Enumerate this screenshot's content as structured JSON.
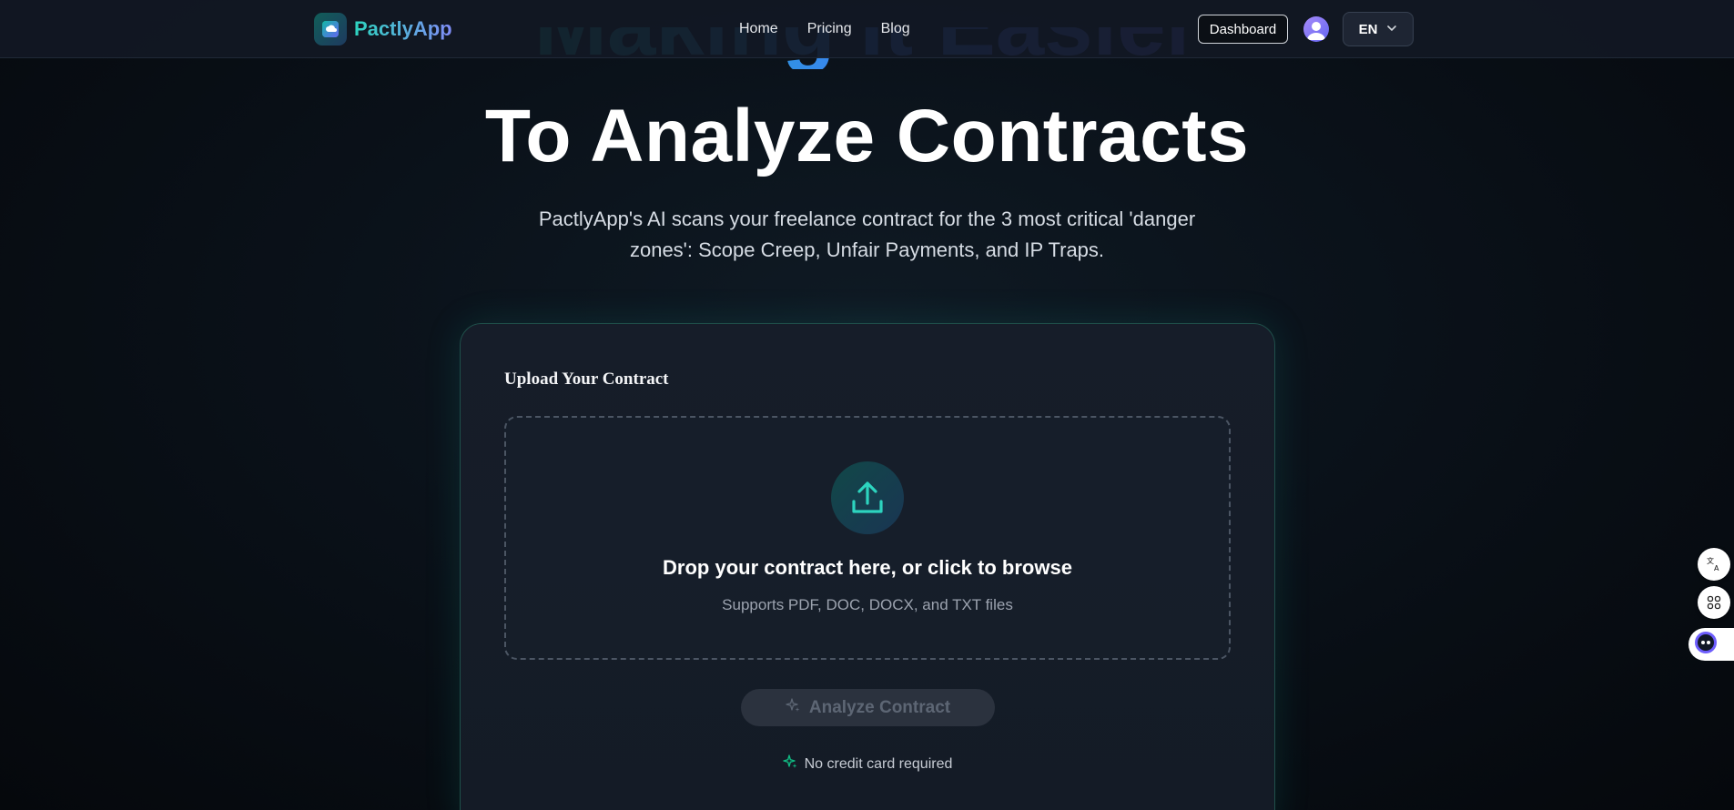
{
  "nav": {
    "brand": "PactlyApp",
    "links": [
      "Home",
      "Pricing",
      "Blog"
    ],
    "dashboard_label": "Dashboard",
    "language": "EN"
  },
  "hero": {
    "title_top": "Making It Easier",
    "title": "To Analyze Contracts",
    "subtitle": "PactlyApp's AI scans your freelance contract for the 3 most critical 'danger zones': Scope Creep, Unfair Payments, and IP Traps."
  },
  "upload": {
    "title": "Upload Your Contract",
    "drop_title": "Drop your contract here, or click to browse",
    "drop_sub": "Supports PDF, DOC, DOCX, and TXT files",
    "analyze_label": "Analyze Contract",
    "no_card": "No credit card required"
  },
  "colors": {
    "accent_teal": "#14b8a6",
    "accent_indigo": "#6366f1",
    "background": "#0a1119"
  },
  "icons": [
    "brand-logo-icon",
    "user-avatar-icon",
    "chevron-down-icon",
    "upload-icon",
    "sparkles-icon",
    "translate-icon",
    "apps-icon",
    "assistant-icon"
  ]
}
